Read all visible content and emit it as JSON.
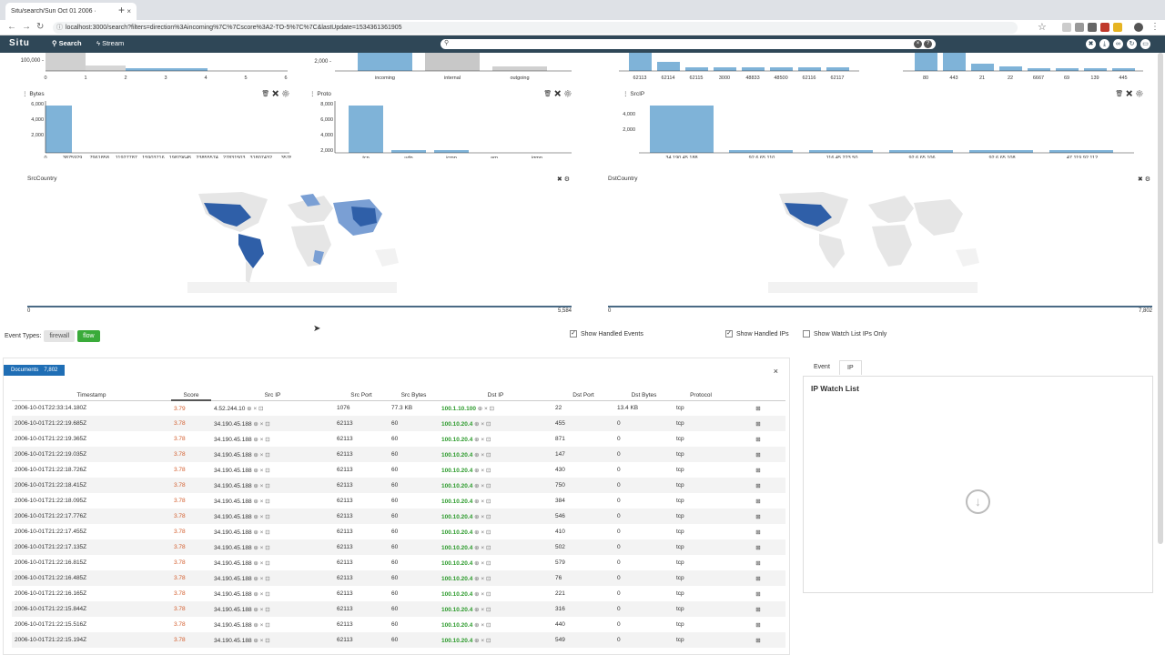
{
  "browser": {
    "tab_title": "Situ/search/Sun Oct 01 2006 ·",
    "tab_close": "×",
    "new_tab": "+",
    "url": "localhost:3000/search?filters=direction%3Aincoming%7C%7Cscore%3A2-TO-5%7C%7C&lastUpdate=1534361361905"
  },
  "app": {
    "logo": "Situ",
    "nav": {
      "search": "Search",
      "stream": "Stream"
    }
  },
  "charts": {
    "top_row": {
      "a_ticks": [
        "0",
        "1",
        "2",
        "3",
        "4",
        "5",
        "6"
      ],
      "a_ylabel": "100,000 -",
      "b_ticks": [
        "incoming",
        "internal",
        "outgoing"
      ],
      "b_ylabel": "2,000 -",
      "c_ticks": [
        "62113",
        "62114",
        "62115",
        "3000",
        "48833",
        "48500",
        "62116",
        "62117"
      ],
      "d_ticks": [
        "80",
        "443",
        "21",
        "22",
        "6667",
        "69",
        "139",
        "445"
      ]
    },
    "bytes": {
      "title": "Bytes",
      "yticks": [
        "6,000",
        "4,000",
        "2,000"
      ],
      "xticks": [
        "0",
        "3875929",
        "7961858",
        "11927787",
        "15903716",
        "19879645",
        "23855574",
        "27831503",
        "31807432",
        "35783"
      ]
    },
    "proto": {
      "title": "Proto",
      "yticks": [
        "8,000",
        "6,000",
        "4,000",
        "2,000"
      ],
      "xticks": [
        "tcp",
        "udp",
        "icmp",
        "arp",
        "igmp"
      ]
    },
    "srcip": {
      "title": "SrcIP",
      "yticks": [
        "4,000",
        "2,000"
      ],
      "xticks": [
        "34.190.45.188",
        "92.6.65.110",
        "116.45.223.50",
        "92.6.65.106",
        "92.6.65.108",
        "47.119.92.112"
      ]
    },
    "srccountry": {
      "title": "SrcCountry",
      "min": "0",
      "max": "5,584"
    },
    "dstcountry": {
      "title": "DstCountry",
      "min": "0",
      "max": "7,802"
    }
  },
  "chart_data": [
    {
      "type": "bar",
      "title": "Bytes",
      "categories": [
        "0",
        "3875929",
        "7961858",
        "11927787",
        "15903716",
        "19879645",
        "23855574",
        "27831503",
        "31807432",
        "35783"
      ],
      "values": [
        7800,
        0,
        0,
        0,
        0,
        0,
        0,
        0,
        0,
        0
      ],
      "ylim": [
        0,
        8000
      ]
    },
    {
      "type": "bar",
      "title": "Proto",
      "categories": [
        "tcp",
        "udp",
        "icmp",
        "arp",
        "igmp"
      ],
      "values": [
        7700,
        250,
        200,
        0,
        0
      ],
      "ylim": [
        0,
        8000
      ]
    },
    {
      "type": "bar",
      "title": "SrcIP",
      "categories": [
        "34.190.45.188",
        "92.6.65.110",
        "116.45.223.50",
        "92.6.65.106",
        "92.6.65.108",
        "47.119.92.112"
      ],
      "values": [
        5300,
        200,
        200,
        200,
        200,
        200
      ],
      "ylim": [
        0,
        5500
      ]
    }
  ],
  "controls": {
    "event_types_label": "Event Types:",
    "firewall": "firewall",
    "flow": "flow",
    "show_handled_events": "Show Handled Events",
    "show_handled_ips": "Show Handled IPs",
    "show_watch_list": "Show Watch List IPs Only"
  },
  "documents": {
    "label": "Documents",
    "count": "7,802",
    "columns": [
      "Timestamp",
      "Score",
      "Src IP",
      "Src Port",
      "Src Bytes",
      "Dst IP",
      "Dst Port",
      "Dst Bytes",
      "Protocol"
    ],
    "rows": [
      [
        "2006-10-01T22:33:14.180Z",
        "3.79",
        "4.52.244.10",
        "1076",
        "77.3 KB",
        "100.1.10.100",
        "22",
        "13.4 KB",
        "tcp"
      ],
      [
        "2006-10-01T21:22:19.685Z",
        "3.78",
        "34.190.45.188",
        "62113",
        "60",
        "100.10.20.4",
        "455",
        "0",
        "tcp"
      ],
      [
        "2006-10-01T21:22:19.365Z",
        "3.78",
        "34.190.45.188",
        "62113",
        "60",
        "100.10.20.4",
        "871",
        "0",
        "tcp"
      ],
      [
        "2006-10-01T21:22:19.035Z",
        "3.78",
        "34.190.45.188",
        "62113",
        "60",
        "100.10.20.4",
        "147",
        "0",
        "tcp"
      ],
      [
        "2006-10-01T21:22:18.726Z",
        "3.78",
        "34.190.45.188",
        "62113",
        "60",
        "100.10.20.4",
        "430",
        "0",
        "tcp"
      ],
      [
        "2006-10-01T21:22:18.415Z",
        "3.78",
        "34.190.45.188",
        "62113",
        "60",
        "100.10.20.4",
        "750",
        "0",
        "tcp"
      ],
      [
        "2006-10-01T21:22:18.095Z",
        "3.78",
        "34.190.45.188",
        "62113",
        "60",
        "100.10.20.4",
        "384",
        "0",
        "tcp"
      ],
      [
        "2006-10-01T21:22:17.776Z",
        "3.78",
        "34.190.45.188",
        "62113",
        "60",
        "100.10.20.4",
        "546",
        "0",
        "tcp"
      ],
      [
        "2006-10-01T21:22:17.455Z",
        "3.78",
        "34.190.45.188",
        "62113",
        "60",
        "100.10.20.4",
        "410",
        "0",
        "tcp"
      ],
      [
        "2006-10-01T21:22:17.135Z",
        "3.78",
        "34.190.45.188",
        "62113",
        "60",
        "100.10.20.4",
        "502",
        "0",
        "tcp"
      ],
      [
        "2006-10-01T21:22:16.815Z",
        "3.78",
        "34.190.45.188",
        "62113",
        "60",
        "100.10.20.4",
        "579",
        "0",
        "tcp"
      ],
      [
        "2006-10-01T21:22:16.485Z",
        "3.78",
        "34.190.45.188",
        "62113",
        "60",
        "100.10.20.4",
        "76",
        "0",
        "tcp"
      ],
      [
        "2006-10-01T21:22:16.165Z",
        "3.78",
        "34.190.45.188",
        "62113",
        "60",
        "100.10.20.4",
        "221",
        "0",
        "tcp"
      ],
      [
        "2006-10-01T21:22:15.844Z",
        "3.78",
        "34.190.45.188",
        "62113",
        "60",
        "100.10.20.4",
        "316",
        "0",
        "tcp"
      ],
      [
        "2006-10-01T21:22:15.516Z",
        "3.78",
        "34.190.45.188",
        "62113",
        "60",
        "100.10.20.4",
        "440",
        "0",
        "tcp"
      ],
      [
        "2006-10-01T21:22:15.194Z",
        "3.78",
        "34.190.45.188",
        "62113",
        "60",
        "100.10.20.4",
        "549",
        "0",
        "tcp"
      ]
    ]
  },
  "side": {
    "tab_event": "Event",
    "tab_ip": "IP",
    "title": "IP Watch List"
  },
  "colors": {
    "bar": "#7fb3d8",
    "appbar": "#2f4757",
    "map_high": "#2f5fa8",
    "map_mid": "#7a9fd4"
  }
}
